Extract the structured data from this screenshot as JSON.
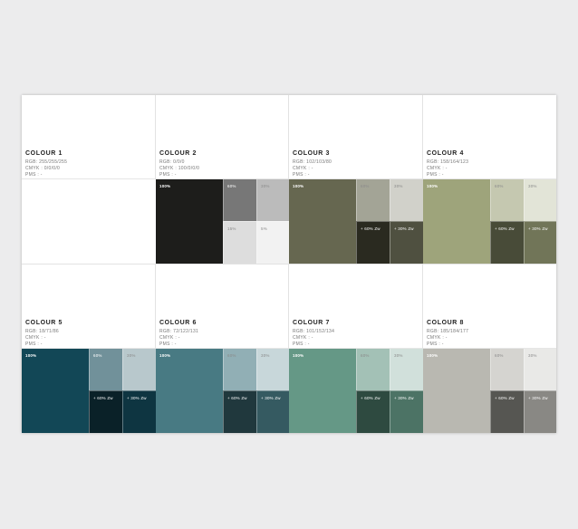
{
  "colours": [
    {
      "name": "COLOUR 1",
      "rgb": "RGB: 255/255/255",
      "cmyk": "CMYK : 0/0/0/0",
      "pms": "PMS : -",
      "main": "#ffffff",
      "c60": "#ffffff",
      "c30": "#ffffff",
      "bl": "#ffffff",
      "br": "#ffffff",
      "l100": "",
      "l60": "",
      "l30": "",
      "lbl": "",
      "lbr": ""
    },
    {
      "name": "COLOUR 2",
      "rgb": "RGB: 0/0/0",
      "cmyk": "CMYK : 100/0/0/0",
      "pms": "PMS : -",
      "main": "#1d1d1b",
      "c60": "#777777",
      "c30": "#bbbbbb",
      "bl": "#dddddd",
      "br": "#f2f2f2",
      "l100": "100%",
      "l60": "60%",
      "l30": "30%",
      "lbl": "15%",
      "lbr": "5%"
    },
    {
      "name": "COLOUR 3",
      "rgb": "RGB: 102/103/80",
      "cmyk": "CMYK : -",
      "pms": "PMS : -",
      "main": "#666750",
      "c60": "#a3a496",
      "c30": "#d1d1ca",
      "bl": "#2a2a20",
      "br": "#4f5040",
      "l100": "100%",
      "l60": "60%",
      "l30": "30%",
      "lbl": "+ 60% Zw",
      "lbr": "+ 30% Zw"
    },
    {
      "name": "COLOUR 4",
      "rgb": "RGB: 158/164/123",
      "cmyk": "CMYK : -",
      "pms": "PMS : -",
      "main": "#9ea47b",
      "c60": "#c5c8b0",
      "c30": "#e2e4d7",
      "bl": "#484b38",
      "br": "#717558",
      "l100": "100%",
      "l60": "60%",
      "l30": "30%",
      "lbl": "+ 60% Zw",
      "lbr": "+ 30% Zw"
    },
    {
      "name": "COLOUR 5",
      "rgb": "RGB: 18/71/86",
      "cmyk": "CMYK : -",
      "pms": "PMS : -",
      "main": "#124756",
      "c60": "#71919a",
      "c30": "#b8c8cc",
      "bl": "#0a2128",
      "br": "#0e3541",
      "l100": "100%",
      "l60": "60%",
      "l30": "30%",
      "lbl": "+ 60% Zw",
      "lbr": "+ 30% Zw"
    },
    {
      "name": "COLOUR 6",
      "rgb": "RGB: 72/122/131",
      "cmyk": "CMYK : -",
      "pms": "PMS : -",
      "main": "#487a83",
      "c60": "#91afb5",
      "c30": "#c8d7da",
      "bl": "#20383d",
      "br": "#355a61",
      "l100": "100%",
      "l60": "60%",
      "l30": "30%",
      "lbl": "+ 60% Zw",
      "lbr": "+ 30% Zw"
    },
    {
      "name": "COLOUR 7",
      "rgb": "RGB: 101/152/134",
      "cmyk": "CMYK : -",
      "pms": "PMS : -",
      "main": "#659886",
      "c60": "#a3c1b6",
      "c30": "#d1e0db",
      "bl": "#2e4a40",
      "br": "#4c7365",
      "l100": "100%",
      "l60": "60%",
      "l30": "30%",
      "lbl": "+ 60% Zw",
      "lbr": "+ 30% Zw"
    },
    {
      "name": "COLOUR 8",
      "rgb": "RGB: 185/184/177",
      "cmyk": "CMYK : -",
      "pms": "PMS : -",
      "main": "#b9b8b1",
      "c60": "#d5d4d0",
      "c30": "#e9e9e7",
      "bl": "#565652",
      "br": "#898884",
      "l100": "100%",
      "l60": "60%",
      "l30": "30%",
      "lbl": "+ 60% Zw",
      "lbr": "+ 30% Zw"
    }
  ]
}
